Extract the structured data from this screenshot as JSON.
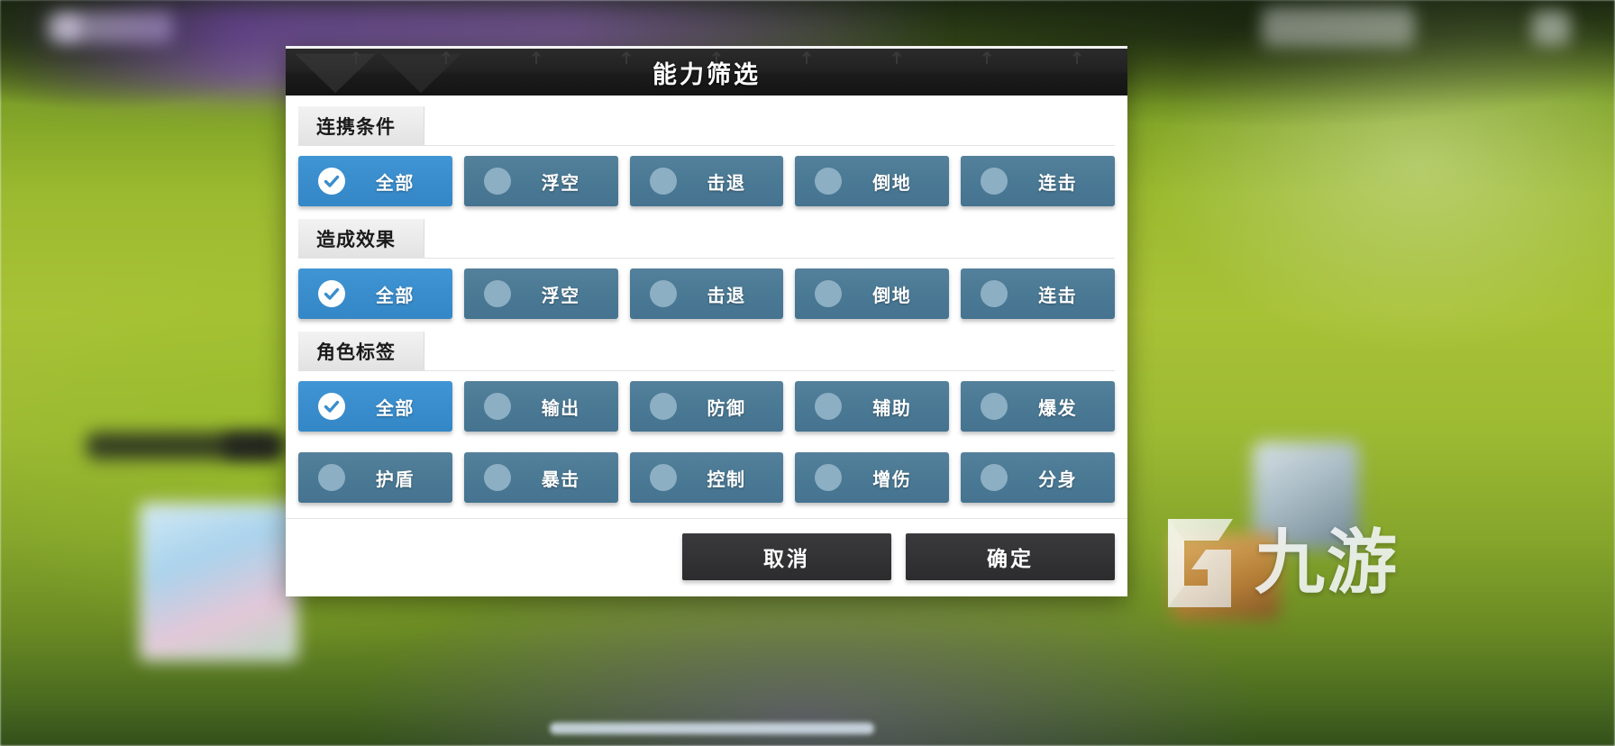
{
  "dialog": {
    "title": "能力筛选"
  },
  "sections": [
    {
      "header": "连携条件",
      "rows": [
        [
          {
            "label": "全部",
            "active": true,
            "icon": "check-circle-icon"
          },
          {
            "label": "浮空",
            "active": false,
            "icon": "circle-icon"
          },
          {
            "label": "击退",
            "active": false,
            "icon": "circle-icon"
          },
          {
            "label": "倒地",
            "active": false,
            "icon": "circle-icon"
          },
          {
            "label": "连击",
            "active": false,
            "icon": "circle-icon"
          }
        ]
      ]
    },
    {
      "header": "造成效果",
      "rows": [
        [
          {
            "label": "全部",
            "active": true,
            "icon": "check-circle-icon"
          },
          {
            "label": "浮空",
            "active": false,
            "icon": "circle-icon"
          },
          {
            "label": "击退",
            "active": false,
            "icon": "circle-icon"
          },
          {
            "label": "倒地",
            "active": false,
            "icon": "circle-icon"
          },
          {
            "label": "连击",
            "active": false,
            "icon": "circle-icon"
          }
        ]
      ]
    },
    {
      "header": "角色标签",
      "rows": [
        [
          {
            "label": "全部",
            "active": true,
            "icon": "check-circle-icon"
          },
          {
            "label": "输出",
            "active": false,
            "icon": "circle-icon"
          },
          {
            "label": "防御",
            "active": false,
            "icon": "circle-icon"
          },
          {
            "label": "辅助",
            "active": false,
            "icon": "circle-icon"
          },
          {
            "label": "爆发",
            "active": false,
            "icon": "circle-icon"
          }
        ],
        [
          {
            "label": "护盾",
            "active": false,
            "icon": "circle-icon"
          },
          {
            "label": "暴击",
            "active": false,
            "icon": "circle-icon"
          },
          {
            "label": "控制",
            "active": false,
            "icon": "circle-icon"
          },
          {
            "label": "增伤",
            "active": false,
            "icon": "circle-icon"
          },
          {
            "label": "分身",
            "active": false,
            "icon": "circle-icon"
          }
        ]
      ]
    }
  ],
  "footer": {
    "cancel_label": "取消",
    "confirm_label": "确定"
  },
  "watermark": {
    "text": "九游"
  },
  "colors": {
    "active_button": "#3a8ecd",
    "inactive_button": "#4b7a95",
    "marker_inactive": "#8cafc4",
    "titlebar": "#1b1b1b",
    "footer_button": "#333335",
    "section_tab": "#eaeaea"
  }
}
